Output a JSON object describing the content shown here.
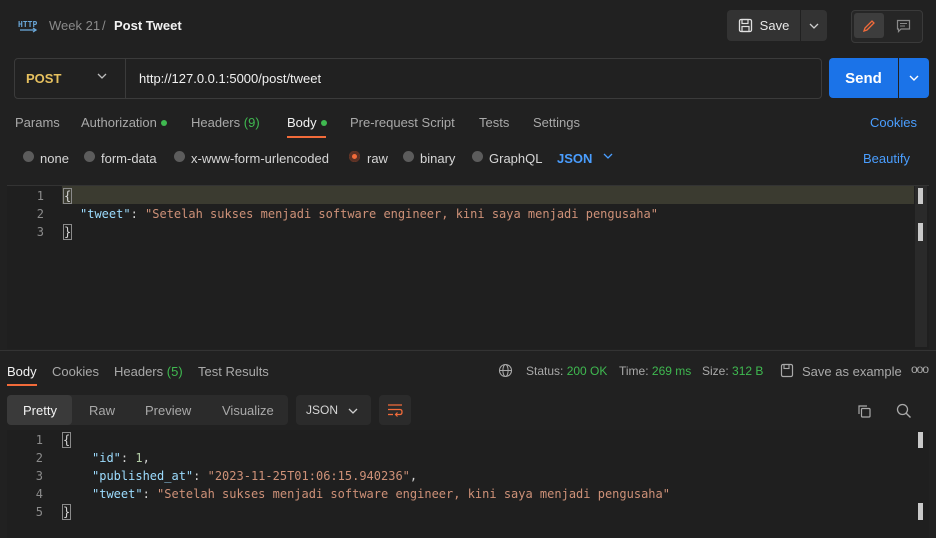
{
  "breadcrumb": {
    "parent": "Week 21",
    "separator": "/",
    "title": "Post Tweet"
  },
  "toolbar": {
    "save_label": "Save"
  },
  "request": {
    "method": "POST",
    "url": "http://127.0.0.1:5000/post/tweet",
    "send_label": "Send"
  },
  "request_tabs": [
    {
      "label": "Params"
    },
    {
      "label": "Authorization"
    },
    {
      "label": "Headers",
      "count": "(9)"
    },
    {
      "label": "Body"
    },
    {
      "label": "Pre-request Script"
    },
    {
      "label": "Tests"
    },
    {
      "label": "Settings"
    }
  ],
  "cookies_link": "Cookies",
  "body_types": [
    "none",
    "form-data",
    "x-www-form-urlencoded",
    "raw",
    "binary",
    "GraphQL"
  ],
  "body_format": "JSON",
  "beautify_label": "Beautify",
  "request_body": {
    "line_numbers": [
      "1",
      "2",
      "3"
    ],
    "open_brace": "{",
    "key": "\"tweet\"",
    "colon": ": ",
    "value": "\"Setelah sukses menjadi software engineer, kini saya menjadi pengusaha\"",
    "close_brace": "}"
  },
  "response_tabs": [
    {
      "label": "Body"
    },
    {
      "label": "Cookies"
    },
    {
      "label": "Headers",
      "count": "(5)"
    },
    {
      "label": "Test Results"
    }
  ],
  "response_status": {
    "status_label": "Status:",
    "status_value": "200 OK",
    "time_label": "Time:",
    "time_value": "269 ms",
    "size_label": "Size:",
    "size_value": "312 B",
    "save_example_label": "Save as example",
    "more_label": "ooo"
  },
  "response_views": [
    "Pretty",
    "Raw",
    "Preview",
    "Visualize"
  ],
  "response_format": "JSON",
  "response_body": {
    "line_numbers": [
      "1",
      "2",
      "3",
      "4",
      "5"
    ],
    "open_brace": "{",
    "id_key": "\"id\"",
    "id_value": "1",
    "published_key": "\"published_at\"",
    "published_value": "\"2023-11-25T01:06:15.940236\"",
    "tweet_key": "\"tweet\"",
    "tweet_value": "\"Setelah sukses menjadi software engineer, kini saya menjadi pengusaha\"",
    "close_brace": "}"
  },
  "colors": {
    "accent_orange": "#f26b3a",
    "send_blue": "#1b73e8",
    "link_blue": "#4a9eff",
    "ok_green": "#3fb950",
    "method_yellow": "#e7c15f"
  }
}
